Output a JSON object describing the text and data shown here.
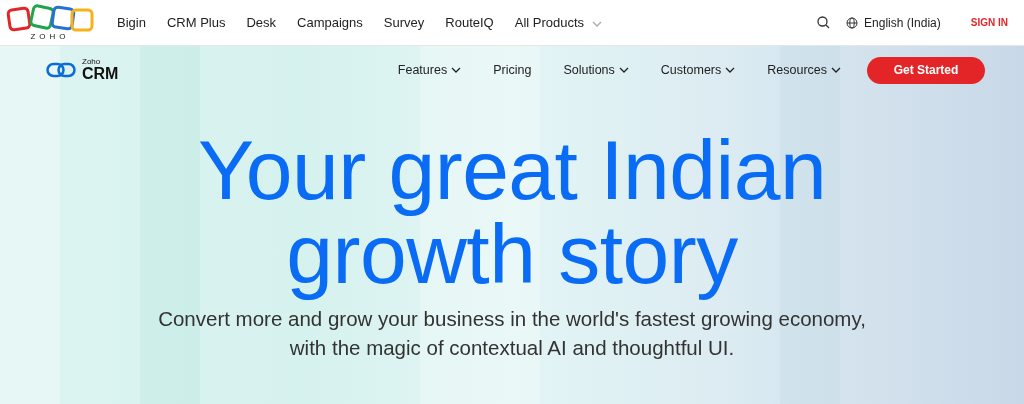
{
  "top_bar": {
    "logo_text": "ZOHO",
    "products": [
      {
        "label": "Bigin",
        "dropdown": false
      },
      {
        "label": "CRM Plus",
        "dropdown": false
      },
      {
        "label": "Desk",
        "dropdown": false
      },
      {
        "label": "Campaigns",
        "dropdown": false
      },
      {
        "label": "Survey",
        "dropdown": false
      },
      {
        "label": "RouteIQ",
        "dropdown": false
      },
      {
        "label": "All Products",
        "dropdown": true
      }
    ],
    "language": "English (India)",
    "sign_in": "SIGN IN"
  },
  "product_nav": {
    "brand_small": "Zoho",
    "brand_big": "CRM",
    "items": [
      {
        "label": "Features",
        "dropdown": true
      },
      {
        "label": "Pricing",
        "dropdown": false
      },
      {
        "label": "Solutions",
        "dropdown": true
      },
      {
        "label": "Customers",
        "dropdown": true
      },
      {
        "label": "Resources",
        "dropdown": true
      }
    ],
    "cta": "Get Started"
  },
  "hero": {
    "headline_lines": [
      "Your great Indian",
      "growth story"
    ],
    "subtitle_lines": [
      "Convert more and grow your business in the world's fastest growing economy,",
      "with the magic of contextual AI and thoughtful UI."
    ]
  }
}
